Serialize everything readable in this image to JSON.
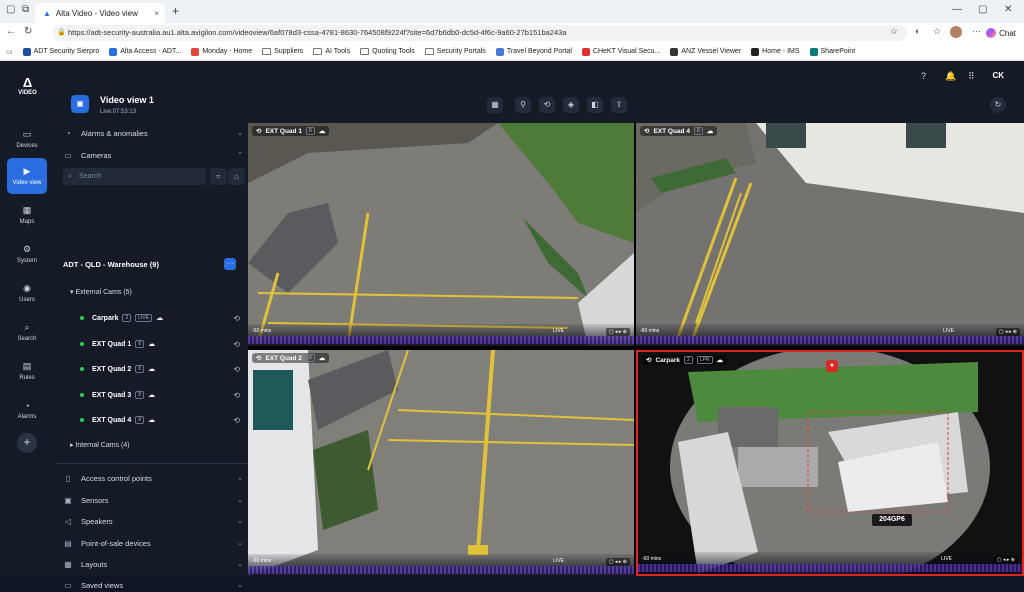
{
  "browser": {
    "tab_title": "Alta Video - Video view",
    "tab_close": "×",
    "new_tab": "+",
    "url": "https://adt-security-australia.au1.alta.avigilon.com/videoview/6af078d3-cssa-4781-8630-764508f9224f?site=6d7b6db0-dc5d-4f6c-9a60-27b151ba243a",
    "chat_label": "Chat",
    "bookmarks": [
      "ADT Security Sierpro",
      "Alta Access - ADT...",
      "Monday - Home",
      "Suppliers",
      "AI Tools",
      "Quoting Tools",
      "Security Portals",
      "Travel Beyond Portal",
      "CHeKT Visual Secu...",
      "ANZ Vessel Viewer",
      "Home - IMS",
      "SharePoint"
    ]
  },
  "rail": {
    "logo": "VIDEO",
    "items": [
      "Devices",
      "Video view",
      "Maps",
      "System",
      "Users",
      "Search",
      "Rules",
      "Alarms"
    ],
    "add": "+"
  },
  "header": {
    "title": "Video view 1",
    "live": "Live:07:53:13",
    "user": "CK"
  },
  "panel": {
    "alarms": "Alarms & anomalies",
    "cameras": "Cameras",
    "search_placeholder": "Search",
    "site": "ADT - QLD - Warehouse (9)",
    "site_btn": "···",
    "external_group": "External Cams (5)",
    "internal_group": "Internal Cams (4)",
    "cameras_list": [
      "Carpark",
      "EXT Quad 1",
      "EXT Quad 2",
      "EXT Quad 3",
      "EXT Quad 4"
    ],
    "live_tag": "LIVE",
    "sections": [
      "Access control points",
      "Sensors",
      "Speakers",
      "Point-of-sale devices",
      "Layouts",
      "Saved views"
    ]
  },
  "grid": {
    "tiles": [
      {
        "name": "EXT Quad 1",
        "foot_left": "-60 mins",
        "live": "LIVE"
      },
      {
        "name": "EXT Quad 4",
        "foot_left": "-60 mins",
        "live": "LIVE"
      },
      {
        "name": "EXT Quad 2",
        "foot_left": "-60 mins",
        "live": "LIVE"
      },
      {
        "name": "Carpark",
        "foot_left": "-60 mins",
        "live": "LIVE"
      }
    ],
    "plate_text": "204GP6",
    "accent_color": "#2a6de0",
    "selected_border": "#e02525"
  }
}
